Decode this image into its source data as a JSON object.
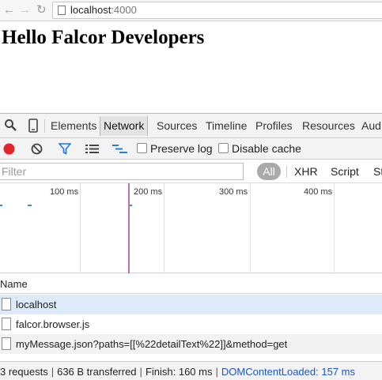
{
  "browser": {
    "url_host": "localhost",
    "url_port": ":4000"
  },
  "page": {
    "heading": "Hello Falcor Developers"
  },
  "devtools": {
    "tabs": [
      "Elements",
      "Network",
      "Sources",
      "Timeline",
      "Profiles",
      "Resources",
      "Aud"
    ],
    "active_tab": "Network",
    "toolbar": {
      "preserve_log": "Preserve log",
      "disable_cache": "Disable cache"
    },
    "filter": {
      "placeholder": "Filter",
      "all": "All",
      "types": [
        "XHR",
        "Script",
        "St"
      ]
    },
    "timeline": {
      "ticks": [
        "100 ms",
        "200 ms",
        "300 ms",
        "400 ms"
      ],
      "load_marker_ms": 157
    },
    "name_header": "Name",
    "requests": [
      {
        "name": "localhost",
        "selected": true
      },
      {
        "name": "falcor.browser.js",
        "selected": false
      },
      {
        "name": "myMessage.json?paths=[[%22detailText%22]]&method=get",
        "selected": false
      }
    ],
    "status": {
      "requests": "3 requests",
      "transferred": "636 B transferred",
      "finish": "Finish: 160 ms",
      "dcl": "DOMContentLoaded: 157 ms"
    },
    "colors": {
      "selected_row": "#dceaf9",
      "alt_row": "#f2f2f2",
      "record": "#e0262b",
      "filter_icon": "#1a73e8",
      "dcl_text": "#1a55c8"
    }
  }
}
